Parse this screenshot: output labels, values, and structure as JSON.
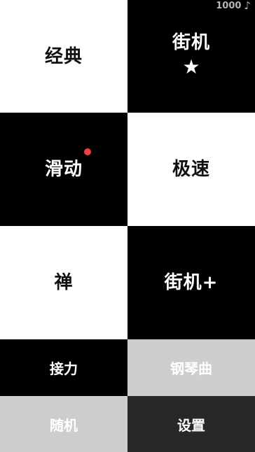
{
  "score": {
    "value": "1000",
    "icon": "music-note-icon"
  },
  "modes": [
    {
      "label": "经典",
      "color": "white"
    },
    {
      "label": "街机",
      "color": "black",
      "badge": "star-icon"
    },
    {
      "label": "滑动",
      "color": "black",
      "dot_color": "#f04040"
    },
    {
      "label": "极速",
      "color": "white"
    },
    {
      "label": "禅",
      "color": "white"
    },
    {
      "label": "街机+",
      "color": "black"
    }
  ],
  "menu": {
    "relay": "接力",
    "piano": "钢琴曲",
    "random": "随机",
    "settings": "设置"
  },
  "colors": {
    "tile_black": "#000000",
    "tile_white": "#ffffff",
    "button_gray": "#cdcdcd",
    "button_dark": "#282828",
    "notification_dot": "#f04040",
    "score_text": "#b5b5b5"
  }
}
